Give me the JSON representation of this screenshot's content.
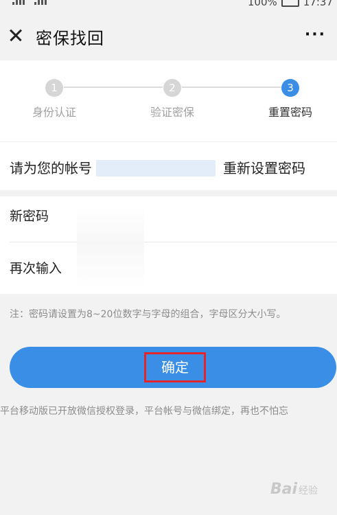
{
  "status_bar": {
    "battery": "100%",
    "time": "17:37"
  },
  "nav": {
    "title": "密保找回",
    "more_label": "···"
  },
  "steps": [
    {
      "number": "1",
      "label": "身份认证",
      "active": false
    },
    {
      "number": "2",
      "label": "验证密保",
      "active": false
    },
    {
      "number": "3",
      "label": "重置密码",
      "active": true
    }
  ],
  "account": {
    "prefix": "请为您的帐号",
    "suffix": "重新设置密码"
  },
  "password_fields": [
    {
      "label": "新密码",
      "value": ""
    },
    {
      "label": "再次输入",
      "value": ""
    }
  ],
  "note": "注：密码请设置为8~20位数字与字母的组合，字母区分大小写。",
  "confirm_button": "确定",
  "footer_tip": "平台移动版已开放微信授权登录，平台帐号与微信绑定，再也不怕忘",
  "watermark": {
    "text": "Bai",
    "suffix": "经验"
  },
  "colors": {
    "accent": "#3a8ee6",
    "highlight_box": "#e3242b",
    "background": "#f2f2f2"
  }
}
